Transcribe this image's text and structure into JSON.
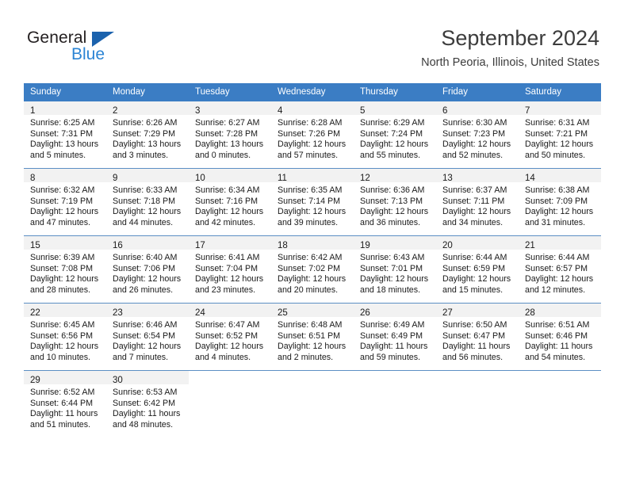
{
  "brand": {
    "name_top": "General",
    "name_bottom": "Blue",
    "accent_color": "#2b84d4",
    "triangle_color": "#1b62ad"
  },
  "header": {
    "title": "September 2024",
    "subtitle": "North Peoria, Illinois, United States"
  },
  "calendar": {
    "header_background": "#3b7dc4",
    "header_text_color": "#ffffff",
    "daynum_band_color": "#f2f2f2",
    "row_separator_color": "#5c8fc4",
    "weekdays": [
      "Sunday",
      "Monday",
      "Tuesday",
      "Wednesday",
      "Thursday",
      "Friday",
      "Saturday"
    ],
    "weeks": [
      [
        {
          "day": "1",
          "lines": [
            "Sunrise: 6:25 AM",
            "Sunset: 7:31 PM",
            "Daylight: 13 hours",
            "and 5 minutes."
          ]
        },
        {
          "day": "2",
          "lines": [
            "Sunrise: 6:26 AM",
            "Sunset: 7:29 PM",
            "Daylight: 13 hours",
            "and 3 minutes."
          ]
        },
        {
          "day": "3",
          "lines": [
            "Sunrise: 6:27 AM",
            "Sunset: 7:28 PM",
            "Daylight: 13 hours",
            "and 0 minutes."
          ]
        },
        {
          "day": "4",
          "lines": [
            "Sunrise: 6:28 AM",
            "Sunset: 7:26 PM",
            "Daylight: 12 hours",
            "and 57 minutes."
          ]
        },
        {
          "day": "5",
          "lines": [
            "Sunrise: 6:29 AM",
            "Sunset: 7:24 PM",
            "Daylight: 12 hours",
            "and 55 minutes."
          ]
        },
        {
          "day": "6",
          "lines": [
            "Sunrise: 6:30 AM",
            "Sunset: 7:23 PM",
            "Daylight: 12 hours",
            "and 52 minutes."
          ]
        },
        {
          "day": "7",
          "lines": [
            "Sunrise: 6:31 AM",
            "Sunset: 7:21 PM",
            "Daylight: 12 hours",
            "and 50 minutes."
          ]
        }
      ],
      [
        {
          "day": "8",
          "lines": [
            "Sunrise: 6:32 AM",
            "Sunset: 7:19 PM",
            "Daylight: 12 hours",
            "and 47 minutes."
          ]
        },
        {
          "day": "9",
          "lines": [
            "Sunrise: 6:33 AM",
            "Sunset: 7:18 PM",
            "Daylight: 12 hours",
            "and 44 minutes."
          ]
        },
        {
          "day": "10",
          "lines": [
            "Sunrise: 6:34 AM",
            "Sunset: 7:16 PM",
            "Daylight: 12 hours",
            "and 42 minutes."
          ]
        },
        {
          "day": "11",
          "lines": [
            "Sunrise: 6:35 AM",
            "Sunset: 7:14 PM",
            "Daylight: 12 hours",
            "and 39 minutes."
          ]
        },
        {
          "day": "12",
          "lines": [
            "Sunrise: 6:36 AM",
            "Sunset: 7:13 PM",
            "Daylight: 12 hours",
            "and 36 minutes."
          ]
        },
        {
          "day": "13",
          "lines": [
            "Sunrise: 6:37 AM",
            "Sunset: 7:11 PM",
            "Daylight: 12 hours",
            "and 34 minutes."
          ]
        },
        {
          "day": "14",
          "lines": [
            "Sunrise: 6:38 AM",
            "Sunset: 7:09 PM",
            "Daylight: 12 hours",
            "and 31 minutes."
          ]
        }
      ],
      [
        {
          "day": "15",
          "lines": [
            "Sunrise: 6:39 AM",
            "Sunset: 7:08 PM",
            "Daylight: 12 hours",
            "and 28 minutes."
          ]
        },
        {
          "day": "16",
          "lines": [
            "Sunrise: 6:40 AM",
            "Sunset: 7:06 PM",
            "Daylight: 12 hours",
            "and 26 minutes."
          ]
        },
        {
          "day": "17",
          "lines": [
            "Sunrise: 6:41 AM",
            "Sunset: 7:04 PM",
            "Daylight: 12 hours",
            "and 23 minutes."
          ]
        },
        {
          "day": "18",
          "lines": [
            "Sunrise: 6:42 AM",
            "Sunset: 7:02 PM",
            "Daylight: 12 hours",
            "and 20 minutes."
          ]
        },
        {
          "day": "19",
          "lines": [
            "Sunrise: 6:43 AM",
            "Sunset: 7:01 PM",
            "Daylight: 12 hours",
            "and 18 minutes."
          ]
        },
        {
          "day": "20",
          "lines": [
            "Sunrise: 6:44 AM",
            "Sunset: 6:59 PM",
            "Daylight: 12 hours",
            "and 15 minutes."
          ]
        },
        {
          "day": "21",
          "lines": [
            "Sunrise: 6:44 AM",
            "Sunset: 6:57 PM",
            "Daylight: 12 hours",
            "and 12 minutes."
          ]
        }
      ],
      [
        {
          "day": "22",
          "lines": [
            "Sunrise: 6:45 AM",
            "Sunset: 6:56 PM",
            "Daylight: 12 hours",
            "and 10 minutes."
          ]
        },
        {
          "day": "23",
          "lines": [
            "Sunrise: 6:46 AM",
            "Sunset: 6:54 PM",
            "Daylight: 12 hours",
            "and 7 minutes."
          ]
        },
        {
          "day": "24",
          "lines": [
            "Sunrise: 6:47 AM",
            "Sunset: 6:52 PM",
            "Daylight: 12 hours",
            "and 4 minutes."
          ]
        },
        {
          "day": "25",
          "lines": [
            "Sunrise: 6:48 AM",
            "Sunset: 6:51 PM",
            "Daylight: 12 hours",
            "and 2 minutes."
          ]
        },
        {
          "day": "26",
          "lines": [
            "Sunrise: 6:49 AM",
            "Sunset: 6:49 PM",
            "Daylight: 11 hours",
            "and 59 minutes."
          ]
        },
        {
          "day": "27",
          "lines": [
            "Sunrise: 6:50 AM",
            "Sunset: 6:47 PM",
            "Daylight: 11 hours",
            "and 56 minutes."
          ]
        },
        {
          "day": "28",
          "lines": [
            "Sunrise: 6:51 AM",
            "Sunset: 6:46 PM",
            "Daylight: 11 hours",
            "and 54 minutes."
          ]
        }
      ],
      [
        {
          "day": "29",
          "lines": [
            "Sunrise: 6:52 AM",
            "Sunset: 6:44 PM",
            "Daylight: 11 hours",
            "and 51 minutes."
          ]
        },
        {
          "day": "30",
          "lines": [
            "Sunrise: 6:53 AM",
            "Sunset: 6:42 PM",
            "Daylight: 11 hours",
            "and 48 minutes."
          ]
        },
        {
          "day": "",
          "lines": []
        },
        {
          "day": "",
          "lines": []
        },
        {
          "day": "",
          "lines": []
        },
        {
          "day": "",
          "lines": []
        },
        {
          "day": "",
          "lines": []
        }
      ]
    ]
  }
}
